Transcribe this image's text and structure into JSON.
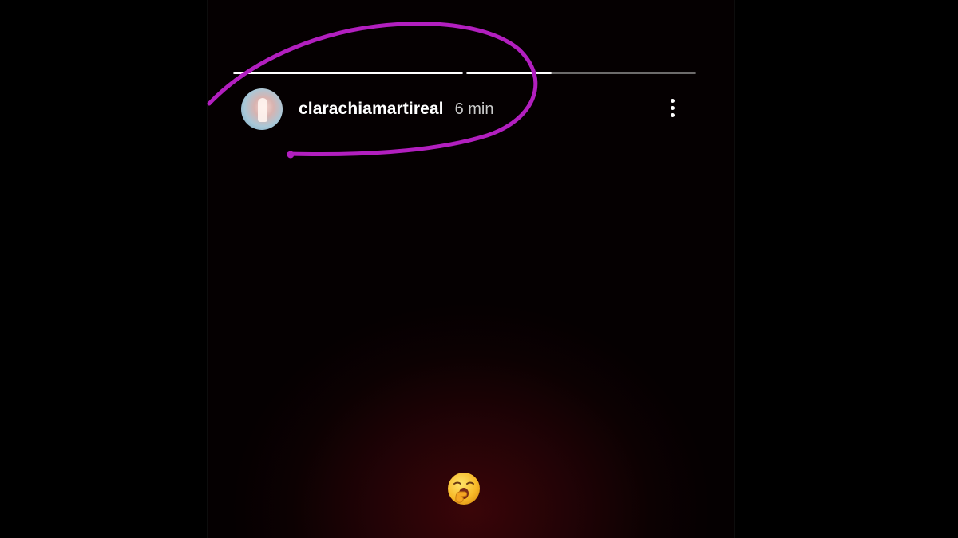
{
  "story": {
    "progress": [
      {
        "fill": 1.0
      },
      {
        "fill": 0.37
      }
    ],
    "author": {
      "username": "clarachiamartireal",
      "time": "6 min"
    },
    "menu_icon": "more-vertical-icon",
    "sticker": {
      "icon": "yawning-face-emoji"
    }
  },
  "annotation": {
    "color": "#b21fbf",
    "shape": "circled-highlight"
  }
}
